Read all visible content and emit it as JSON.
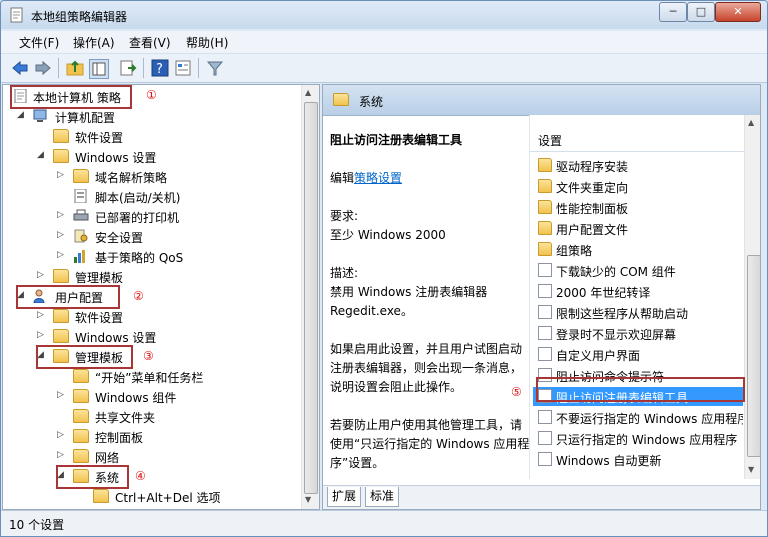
{
  "window": {
    "title": "本地组策略编辑器"
  },
  "window_buttons": {
    "minimize": "─",
    "maximize": "□",
    "close": "✕"
  },
  "menu": [
    "文件(F)",
    "操作(A)",
    "查看(V)",
    "帮助(H)"
  ],
  "tree": [
    {
      "label": "本地计算机 策略",
      "icon": "policy-icon"
    },
    {
      "label": "计算机配置",
      "icon": "computer-icon"
    },
    {
      "label": "软件设置",
      "icon": "folder-icon"
    },
    {
      "label": "Windows 设置",
      "icon": "folder-icon"
    },
    {
      "label": "域名解析策略",
      "icon": "folder-icon"
    },
    {
      "label": "脚本(启动/关机)",
      "icon": "script-icon"
    },
    {
      "label": "已部署的打印机",
      "icon": "printer-icon"
    },
    {
      "label": "安全设置",
      "icon": "security-icon"
    },
    {
      "label": "基于策略的 QoS",
      "icon": "chart-icon"
    },
    {
      "label": "管理模板",
      "icon": "folder-icon"
    },
    {
      "label": "用户配置",
      "icon": "user-icon"
    },
    {
      "label": "软件设置",
      "icon": "folder-icon"
    },
    {
      "label": "Windows 设置",
      "icon": "folder-icon"
    },
    {
      "label": "管理模板",
      "icon": "folder-icon"
    },
    {
      "label": "“开始”菜单和任务栏",
      "icon": "folder-icon"
    },
    {
      "label": "Windows 组件",
      "icon": "folder-icon"
    },
    {
      "label": "共享文件夹",
      "icon": "folder-icon"
    },
    {
      "label": "控制面板",
      "icon": "folder-icon"
    },
    {
      "label": "网络",
      "icon": "folder-icon"
    },
    {
      "label": "系统",
      "icon": "folder-icon"
    },
    {
      "label": "Ctrl+Alt+Del 选项",
      "icon": "folder-icon"
    }
  ],
  "annotations": [
    "①",
    "②",
    "③",
    "④",
    "⑤"
  ],
  "right_header": {
    "title": "系统"
  },
  "description": {
    "title": "阻止访问注册表编辑工具",
    "edit_prefix": "编辑",
    "edit_link": "策略设置",
    "requirement_label": "要求:",
    "requirement_value": "至少 Windows 2000",
    "desc_label": "描述:",
    "desc_value": "禁用 Windows 注册表编辑器 Regedit.exe。",
    "para1": "如果启用此设置，并且用户试图启动注册表编辑器，则会出现一条消息，说明设置会阻止此操作。",
    "para2": "若要防止用户使用其他管理工具，请使用“只运行指定的 Windows 应用程序”设置。"
  },
  "list": {
    "header": "设置",
    "items": [
      {
        "label": "驱动程序安装",
        "type": "folder"
      },
      {
        "label": "文件夹重定向",
        "type": "folder"
      },
      {
        "label": "性能控制面板",
        "type": "folder"
      },
      {
        "label": "用户配置文件",
        "type": "folder"
      },
      {
        "label": "组策略",
        "type": "folder"
      },
      {
        "label": "下载缺少的 COM 组件",
        "type": "setting"
      },
      {
        "label": "2000 年世纪转译",
        "type": "setting"
      },
      {
        "label": "限制这些程序从帮助启动",
        "type": "setting"
      },
      {
        "label": "登录时不显示欢迎屏幕",
        "type": "setting"
      },
      {
        "label": "自定义用户界面",
        "type": "setting"
      },
      {
        "label": "阻止访问命令提示符",
        "type": "setting"
      },
      {
        "label": "阻止访问注册表编辑工具",
        "type": "setting",
        "selected": true
      },
      {
        "label": "不要运行指定的 Windows 应用程序",
        "type": "setting"
      },
      {
        "label": "只运行指定的 Windows 应用程序",
        "type": "setting"
      },
      {
        "label": "Windows 自动更新",
        "type": "setting"
      }
    ]
  },
  "tabs": [
    "扩展",
    "标准"
  ],
  "status": {
    "text": "10 个设置"
  },
  "colors": {
    "annotation_red": "#a83636",
    "selection": "#3399ff",
    "link": "#0066cc"
  }
}
